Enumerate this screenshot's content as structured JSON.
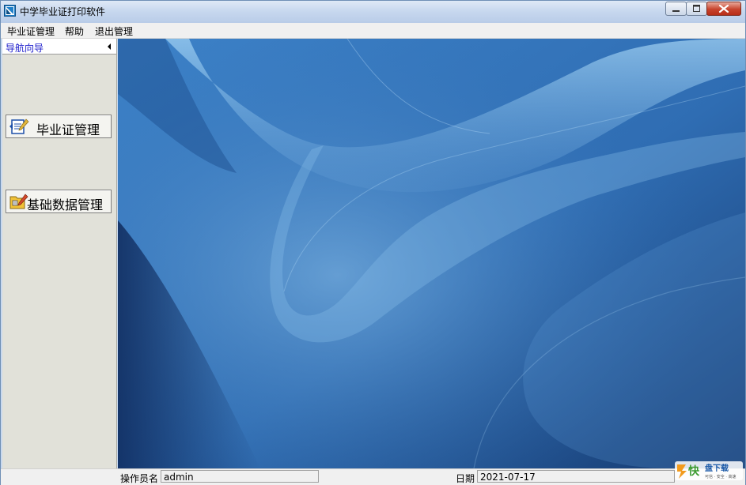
{
  "window": {
    "title": "中学毕业证打印软件",
    "buttons": {
      "minimize": "minimize-icon",
      "maximize": "maximize-icon",
      "close": "close-icon"
    }
  },
  "menubar": {
    "items": [
      {
        "label": "毕业证管理"
      },
      {
        "label": "帮助"
      },
      {
        "label": "退出管理"
      }
    ]
  },
  "nav": {
    "title": "导航向导",
    "buttons": [
      {
        "label": "毕业证管理",
        "icon": "diploma-icon"
      },
      {
        "label": "基础数据管理",
        "icon": "folder-edit-icon"
      }
    ]
  },
  "statusbar": {
    "operator_label": "操作员名",
    "operator_value": "admin",
    "date_label": "日期",
    "date_value": "2021-07-17"
  },
  "watermark": {
    "brand": "快",
    "text": "盘下载",
    "sub": "可信 · 安全 · 高速"
  },
  "colors": {
    "wallpaper": "#2a63a6",
    "nav_panel": "#e1e1d9",
    "nav_header_text": "#1a1acb",
    "close_button": "#c7432c"
  }
}
